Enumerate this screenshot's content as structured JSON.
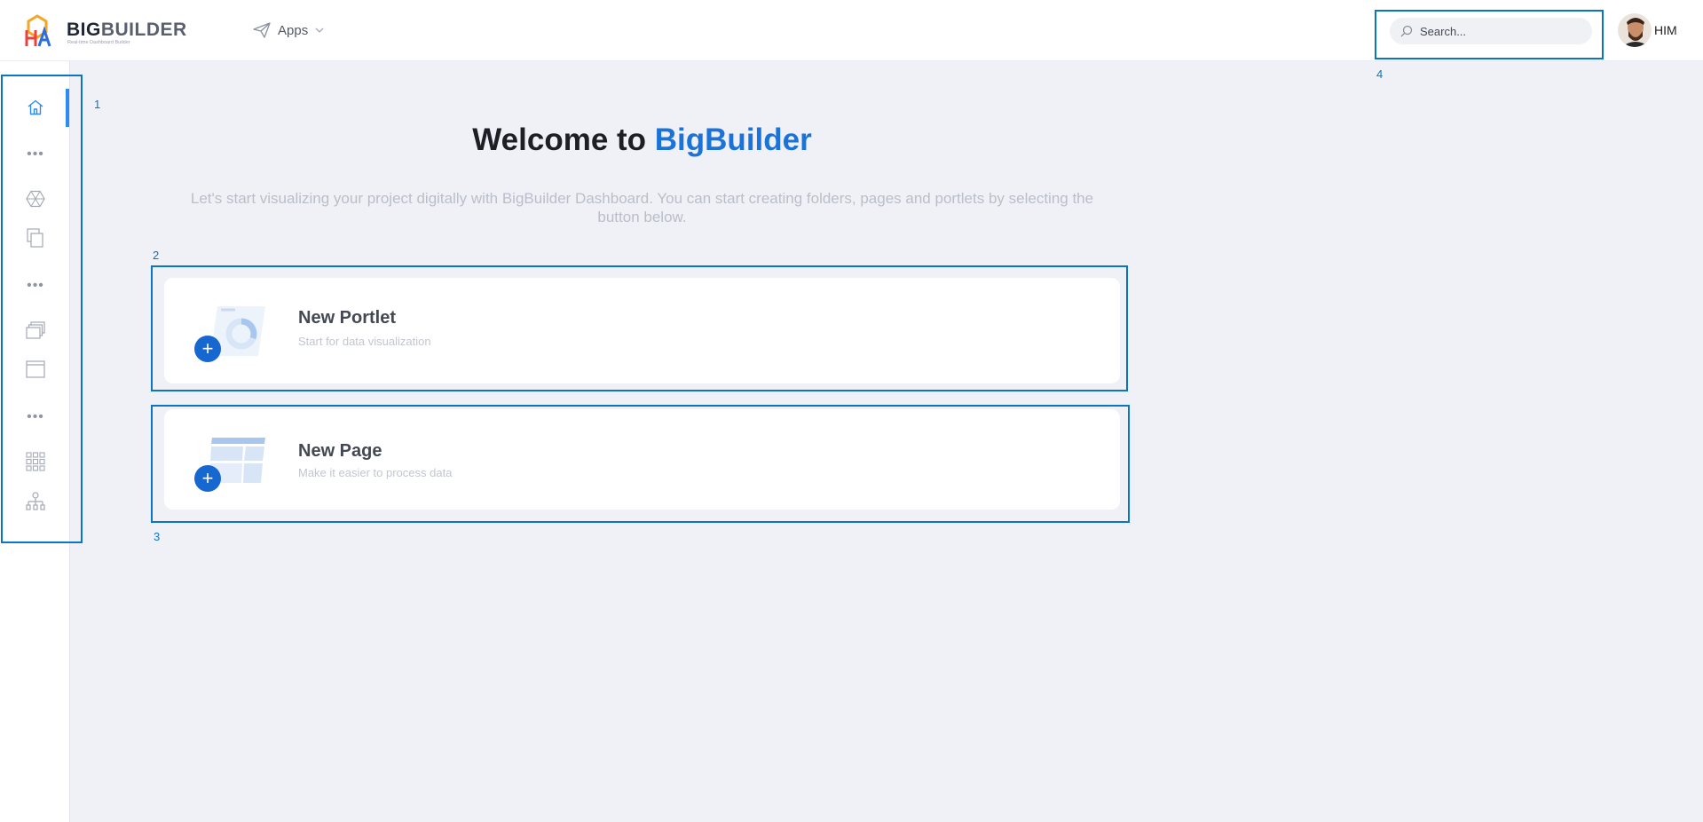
{
  "header": {
    "brand_bold": "BIG",
    "brand_light": "BUILDER",
    "brand_tagline": "Real-time Dashboard Builder",
    "apps_label": "Apps",
    "search_placeholder": "Search...",
    "user_name": "HIM"
  },
  "sidebar": {
    "items": [
      {
        "icon": "home-icon",
        "active": true
      },
      {
        "icon": "more-icon"
      },
      {
        "icon": "hexagon-network-icon"
      },
      {
        "icon": "copy-pages-icon"
      },
      {
        "icon": "more-icon"
      },
      {
        "icon": "layers-icon"
      },
      {
        "icon": "window-icon"
      },
      {
        "icon": "more-icon"
      },
      {
        "icon": "grid-apps-icon"
      },
      {
        "icon": "sitemap-icon"
      }
    ]
  },
  "main": {
    "welcome_prefix": "Welcome to ",
    "welcome_brand": "BigBuilder",
    "intro": "Let's start visualizing your project digitally with BigBuilder Dashboard. You can start creating folders, pages and portlets by selecting the button below.",
    "cards": [
      {
        "title": "New Portlet",
        "subtitle": "Start for data visualization"
      },
      {
        "title": "New Page",
        "subtitle": "Make it easier to process data"
      }
    ]
  },
  "annotations": [
    "1",
    "2",
    "3",
    "4"
  ],
  "colors": {
    "accent": "#1a73d9",
    "annotation": "#0b74c4",
    "background": "#f0f1f6"
  }
}
